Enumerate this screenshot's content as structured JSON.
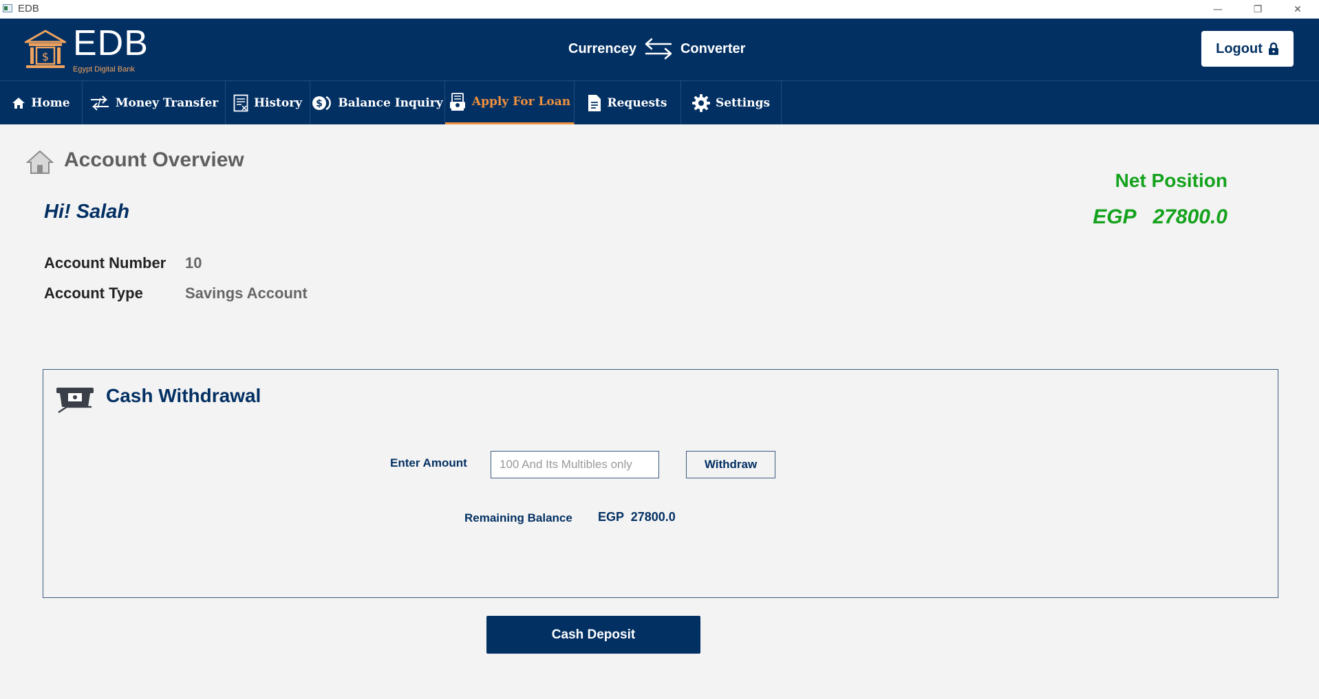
{
  "window": {
    "title": "EDB",
    "minimize": "—",
    "restore": "❐",
    "close": "✕"
  },
  "brand": {
    "name": "EDB",
    "tagline": "Egypt Digital Bank"
  },
  "converter": {
    "left": "Currencey",
    "right": "Converter"
  },
  "logout": {
    "label": "Logout"
  },
  "nav": {
    "items": [
      {
        "label": "Home"
      },
      {
        "label": "Money Transfer"
      },
      {
        "label": "History"
      },
      {
        "label": "Balance Inquiry"
      },
      {
        "label": "Apply For Loan",
        "active": true
      },
      {
        "label": "Requests"
      },
      {
        "label": "Settings"
      }
    ]
  },
  "overview": {
    "title": "Account Overview",
    "greeting": "Hi! Salah",
    "account_number_label": "Account Number",
    "account_number": "10",
    "account_type_label": "Account Type",
    "account_type": "Savings Account",
    "net_position_label": "Net Position",
    "net_position_value": "EGP   27800.0"
  },
  "withdrawal": {
    "title": "Cash Withdrawal",
    "amount_label": "Enter Amount",
    "amount_placeholder": "100 And Its Multibles only",
    "amount_value": "",
    "withdraw_label": "Withdraw",
    "remaining_label": "Remaining Balance",
    "remaining_value": "EGP  27800.0"
  },
  "deposit": {
    "label": "Cash Deposit"
  },
  "colors": {
    "primary": "#033063",
    "accent": "#f0913c",
    "positive": "#14a21c",
    "background": "#f3f3f3"
  }
}
